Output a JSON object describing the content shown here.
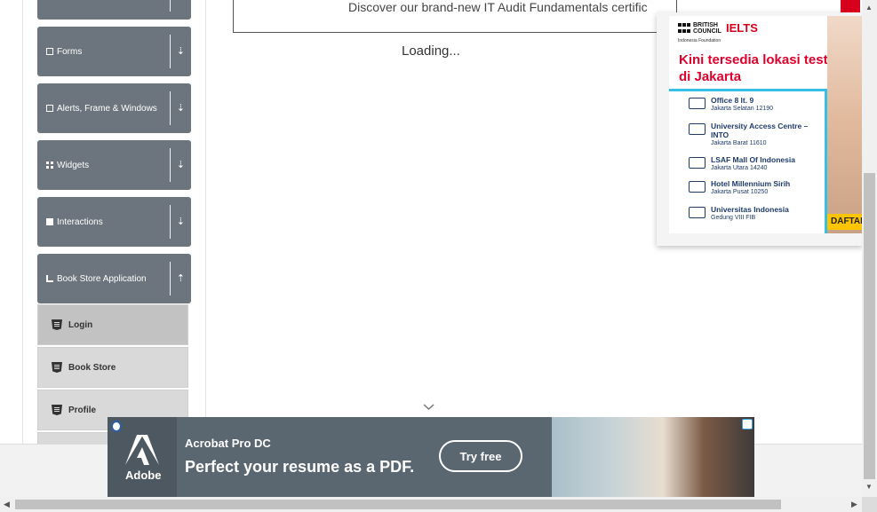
{
  "sidebar": {
    "groups": [
      {
        "label": "Forms",
        "icon": "form-icon",
        "arrow": "⇣"
      },
      {
        "label": "Alerts, Frame & Windows",
        "icon": "window-icon",
        "arrow": "⇣"
      },
      {
        "label": "Widgets",
        "icon": "widgets-icon",
        "arrow": "⇣"
      },
      {
        "label": "Interactions",
        "icon": "interactions-icon",
        "arrow": "⇣"
      },
      {
        "label": "Book Store Application",
        "icon": "book-icon",
        "arrow": "⇡"
      }
    ],
    "book_store_items": [
      {
        "label": "Login",
        "active": true
      },
      {
        "label": "Book Store",
        "active": false
      },
      {
        "label": "Profile",
        "active": false
      }
    ]
  },
  "main": {
    "top_banner_text": "Discover our brand-new IT Audit Fundamentals certific",
    "loading_text": "Loading..."
  },
  "ielts_ad": {
    "brand_line1": "BRITISH",
    "brand_line2": "COUNCIL",
    "product": "IELTS",
    "foundation": "Indonesia Foundation",
    "headline": "Kini tersedia lokasi test di Jakarta",
    "locations": [
      {
        "name": "Office 8 lt. 9",
        "area": "Jakarta Selatan 12190"
      },
      {
        "name": "University Access Centre – INTO",
        "area": "Jakarta Barat 11610"
      },
      {
        "name": "LSAF Mall Of Indonesia",
        "area": "Jakarta Utara 14240"
      },
      {
        "name": "Hotel Millennium Sirih",
        "area": "Jakarta Pusat 10250"
      },
      {
        "name": "Universitas Indonesia",
        "area": "Gedung VIII FIB"
      }
    ],
    "cta": "DAFTAR",
    "accent_color": "#e0002b"
  },
  "adobe_ad": {
    "brand": "Adobe",
    "product": "Acrobat Pro DC",
    "slogan": "Perfect your resume as a PDF.",
    "cta": "Try free"
  },
  "colors": {
    "sidebar_header": "#6c757d",
    "sub_item": "#d9d9d9",
    "sub_item_active": "#c2c2c2",
    "adobe_bg": "#5a6670"
  }
}
